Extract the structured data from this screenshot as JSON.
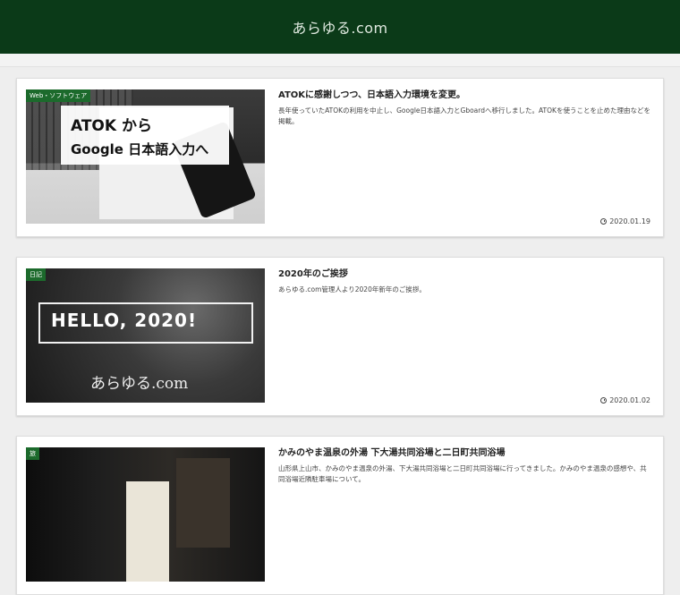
{
  "header": {
    "site_title": "あらゆる.com"
  },
  "posts": [
    {
      "category": "Web・ソフトウェア",
      "thumb_line1": "ATOK から",
      "thumb_line2": "Google 日本語入力へ",
      "title": "ATOKに感謝しつつ、日本語入力環境を変更。",
      "excerpt": "長年使っていたATOKの利用を中止し、Google日本語入力とGboardへ移行しました。ATOKを使うことを止めた理由などを掲載。",
      "date": "2020.01.19"
    },
    {
      "category": "日記",
      "thumb_line1": "HELLO, 2020!",
      "thumb_line2": "あらゆる.com",
      "title": "2020年のご挨拶",
      "excerpt": "あらゆる.com管理人より2020年新年のご挨拶。",
      "date": "2020.01.02"
    },
    {
      "category": "旅",
      "title": "かみのやま温泉の外湯 下大湯共同浴場と二日町共同浴場",
      "excerpt": "山形県上山市、かみのやま温泉の外湯、下大湯共同浴場と二日町共同浴場に行ってきました。かみのやま温泉の感想や、共同浴場近隣駐車場について。",
      "date": ""
    }
  ],
  "icons": {
    "date": "clock-icon"
  },
  "colors": {
    "header_bg": "#0b3a18",
    "category_bg": "#1c6a2c"
  }
}
